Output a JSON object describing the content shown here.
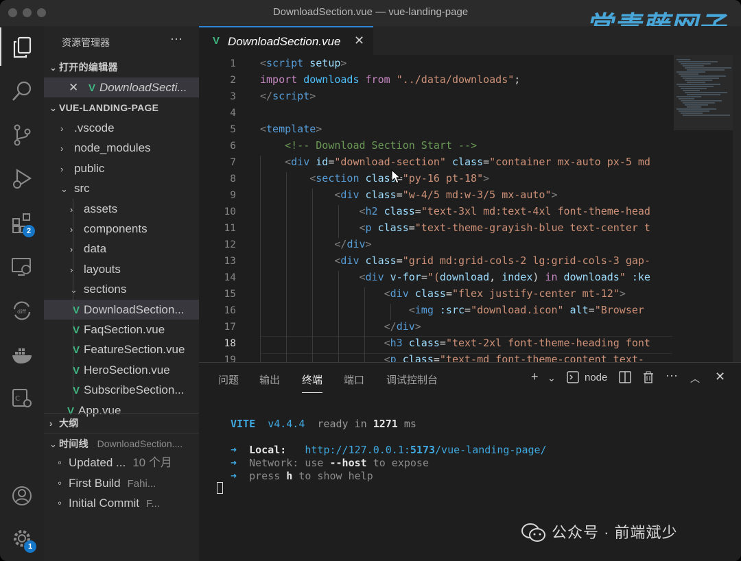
{
  "window": {
    "title": "DownloadSection.vue — vue-landing-page",
    "watermark": "常青藤网子"
  },
  "activity_bar": {
    "extensions_badge": "2",
    "settings_badge": "1"
  },
  "sidebar": {
    "title": "资源管理器",
    "more": "···",
    "open_editors_header": "打开的编辑器",
    "open_editor_file": "DownloadSecti...",
    "project_header": "VUE-LANDING-PAGE",
    "items": [
      {
        "label": ".vscode",
        "type": "folder",
        "depth": 1
      },
      {
        "label": "node_modules",
        "type": "folder",
        "depth": 1
      },
      {
        "label": "public",
        "type": "folder",
        "depth": 1
      },
      {
        "label": "src",
        "type": "folder-open",
        "depth": 1
      },
      {
        "label": "assets",
        "type": "folder",
        "depth": 2
      },
      {
        "label": "components",
        "type": "folder",
        "depth": 2
      },
      {
        "label": "data",
        "type": "folder",
        "depth": 2
      },
      {
        "label": "layouts",
        "type": "folder",
        "depth": 2
      },
      {
        "label": "sections",
        "type": "folder-open",
        "depth": 2
      },
      {
        "label": "DownloadSection...",
        "type": "vue",
        "depth": 3,
        "selected": true
      },
      {
        "label": "FaqSection.vue",
        "type": "vue",
        "depth": 3
      },
      {
        "label": "FeatureSection.vue",
        "type": "vue",
        "depth": 3
      },
      {
        "label": "HeroSection.vue",
        "type": "vue",
        "depth": 3
      },
      {
        "label": "SubscribeSection...",
        "type": "vue",
        "depth": 3
      },
      {
        "label": "App.vue",
        "type": "vue",
        "depth": 2
      }
    ],
    "outline_header": "大纲",
    "timeline_header": "时间线",
    "timeline_file": "DownloadSection....",
    "timeline": [
      {
        "label": "Updated ...",
        "meta": "10 个月"
      },
      {
        "label": "First Build",
        "meta": "Fahi..."
      },
      {
        "label": "Initial Commit",
        "meta": "F..."
      }
    ]
  },
  "editor": {
    "tab_label": "DownloadSection.vue",
    "current_line": 18,
    "lines": [
      [
        {
          "t": "<",
          "c": "tag"
        },
        {
          "t": "script",
          "c": "tn"
        },
        {
          "t": " setup",
          "c": "at"
        },
        {
          "t": ">",
          "c": "tag"
        }
      ],
      [
        {
          "t": "import ",
          "c": "kw"
        },
        {
          "t": "downloads",
          "c": "var"
        },
        {
          "t": " from ",
          "c": "kw"
        },
        {
          "t": "\"../data/downloads\"",
          "c": "st"
        },
        {
          "t": ";",
          "c": "tx"
        }
      ],
      [
        {
          "t": "</",
          "c": "tag"
        },
        {
          "t": "script",
          "c": "tn"
        },
        {
          "t": ">",
          "c": "tag"
        }
      ],
      [],
      [
        {
          "t": "<",
          "c": "tag"
        },
        {
          "t": "template",
          "c": "tn"
        },
        {
          "t": ">",
          "c": "tag"
        }
      ],
      [
        {
          "t": "    <!-- Download Section Start -->",
          "c": "cm"
        }
      ],
      [
        {
          "t": "    <",
          "c": "tag"
        },
        {
          "t": "div",
          "c": "tn"
        },
        {
          "t": " id",
          "c": "at"
        },
        {
          "t": "=",
          "c": "tx"
        },
        {
          "t": "\"download-section\"",
          "c": "st"
        },
        {
          "t": " class",
          "c": "at"
        },
        {
          "t": "=",
          "c": "tx"
        },
        {
          "t": "\"container mx-auto px-5 md",
          "c": "st"
        }
      ],
      [
        {
          "t": "        <",
          "c": "tag"
        },
        {
          "t": "section",
          "c": "tn"
        },
        {
          "t": " class",
          "c": "at"
        },
        {
          "t": "=",
          "c": "tx"
        },
        {
          "t": "\"py-16 pt-18\"",
          "c": "st"
        },
        {
          "t": ">",
          "c": "tag"
        }
      ],
      [
        {
          "t": "            <",
          "c": "tag"
        },
        {
          "t": "div",
          "c": "tn"
        },
        {
          "t": " class",
          "c": "at"
        },
        {
          "t": "=",
          "c": "tx"
        },
        {
          "t": "\"w-4/5 md:w-3/5 mx-auto\"",
          "c": "st"
        },
        {
          "t": ">",
          "c": "tag"
        }
      ],
      [
        {
          "t": "                <",
          "c": "tag"
        },
        {
          "t": "h2",
          "c": "tn"
        },
        {
          "t": " class",
          "c": "at"
        },
        {
          "t": "=",
          "c": "tx"
        },
        {
          "t": "\"text-3xl md:text-4xl font-theme-head",
          "c": "st"
        }
      ],
      [
        {
          "t": "                <",
          "c": "tag"
        },
        {
          "t": "p",
          "c": "tn"
        },
        {
          "t": " class",
          "c": "at"
        },
        {
          "t": "=",
          "c": "tx"
        },
        {
          "t": "\"text-theme-grayish-blue text-center t",
          "c": "st"
        }
      ],
      [
        {
          "t": "            </",
          "c": "tag"
        },
        {
          "t": "div",
          "c": "tn"
        },
        {
          "t": ">",
          "c": "tag"
        }
      ],
      [
        {
          "t": "            <",
          "c": "tag"
        },
        {
          "t": "div",
          "c": "tn"
        },
        {
          "t": " class",
          "c": "at"
        },
        {
          "t": "=",
          "c": "tx"
        },
        {
          "t": "\"grid md:grid-cols-2 lg:grid-cols-3 gap-",
          "c": "st"
        }
      ],
      [
        {
          "t": "                <",
          "c": "tag"
        },
        {
          "t": "div",
          "c": "tn"
        },
        {
          "t": " v-for",
          "c": "at"
        },
        {
          "t": "=",
          "c": "tx"
        },
        {
          "t": "\"(",
          "c": "st"
        },
        {
          "t": "download",
          "c": "at"
        },
        {
          "t": ", ",
          "c": "tx"
        },
        {
          "t": "index",
          "c": "at"
        },
        {
          "t": ") ",
          "c": "tx"
        },
        {
          "t": "in",
          "c": "kw"
        },
        {
          "t": " ",
          "c": "tx"
        },
        {
          "t": "downloads",
          "c": "at"
        },
        {
          "t": "\"",
          "c": "st"
        },
        {
          "t": " :ke",
          "c": "at"
        }
      ],
      [
        {
          "t": "                    <",
          "c": "tag"
        },
        {
          "t": "div",
          "c": "tn"
        },
        {
          "t": " class",
          "c": "at"
        },
        {
          "t": "=",
          "c": "tx"
        },
        {
          "t": "\"flex justify-center mt-12\"",
          "c": "st"
        },
        {
          "t": ">",
          "c": "tag"
        }
      ],
      [
        {
          "t": "                        <",
          "c": "tag"
        },
        {
          "t": "img",
          "c": "tn"
        },
        {
          "t": " :src",
          "c": "at"
        },
        {
          "t": "=",
          "c": "tx"
        },
        {
          "t": "\"download.icon\"",
          "c": "st"
        },
        {
          "t": " alt",
          "c": "at"
        },
        {
          "t": "=",
          "c": "tx"
        },
        {
          "t": "\"Browser",
          "c": "st"
        }
      ],
      [
        {
          "t": "                    </",
          "c": "tag"
        },
        {
          "t": "div",
          "c": "tn"
        },
        {
          "t": ">",
          "c": "tag"
        }
      ],
      [
        {
          "t": "                    <",
          "c": "tag"
        },
        {
          "t": "h3",
          "c": "tn"
        },
        {
          "t": " class",
          "c": "at"
        },
        {
          "t": "=",
          "c": "tx"
        },
        {
          "t": "\"text-2xl font-theme-heading font",
          "c": "st"
        }
      ],
      [
        {
          "t": "                    <",
          "c": "tag"
        },
        {
          "t": "p",
          "c": "tn"
        },
        {
          "t": " class",
          "c": "at"
        },
        {
          "t": "=",
          "c": "tx"
        },
        {
          "t": "\"text-md font-theme-content text-",
          "c": "st"
        }
      ]
    ]
  },
  "panel": {
    "tabs": [
      "问题",
      "输出",
      "终端",
      "端口",
      "调试控制台"
    ],
    "active_tab": "终端",
    "shell": "node",
    "terminal": {
      "vite": "VITE",
      "version": "v4.4.4",
      "ready": "ready in",
      "time": "1271",
      "ms": "ms",
      "local_label": "Local:",
      "local_url_a": "http://127.0.0.1:",
      "local_port": "5173",
      "local_url_b": "/vue-landing-page/",
      "network_label": "Network:",
      "network_a": "use",
      "network_flag": "--host",
      "network_b": "to expose",
      "help_a": "press",
      "help_key": "h",
      "help_b": "to show help"
    }
  },
  "footer": {
    "label": "公众号 · 前端斌少"
  }
}
